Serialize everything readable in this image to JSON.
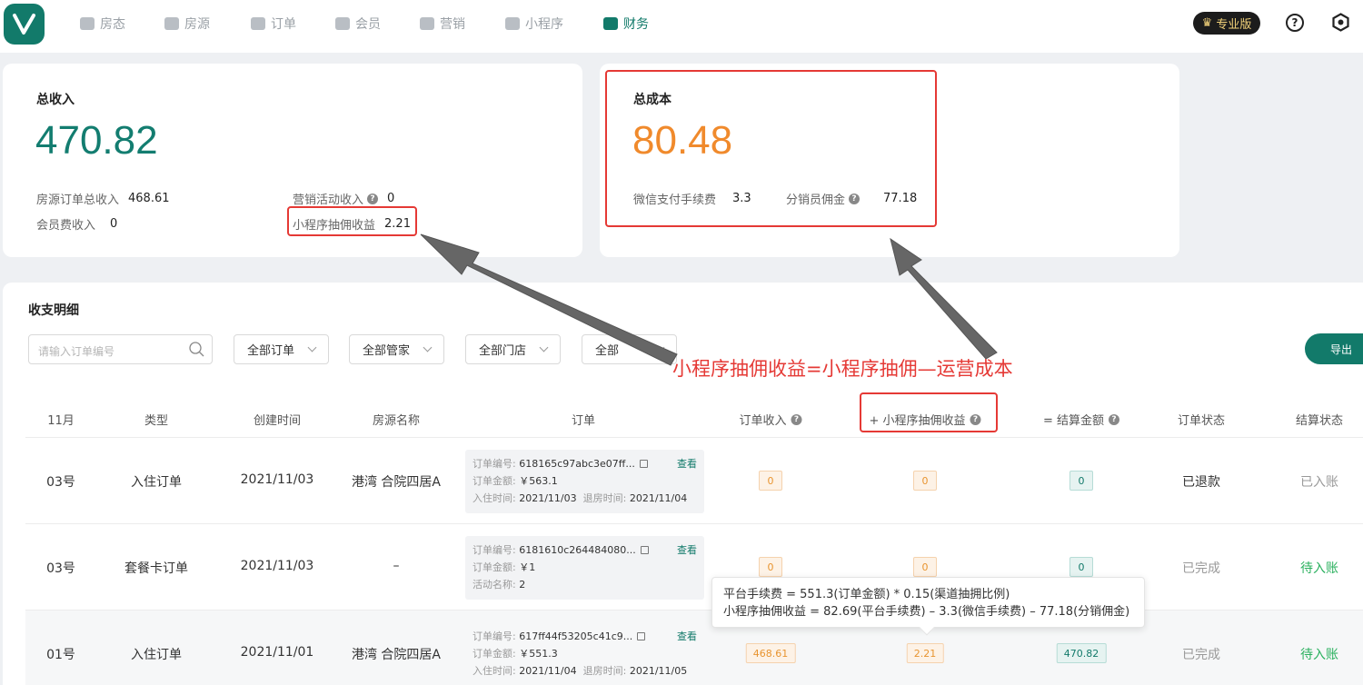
{
  "nav": {
    "items": [
      {
        "label": "房态",
        "icon": "calendar-icon"
      },
      {
        "label": "房源",
        "icon": "building-icon"
      },
      {
        "label": "订单",
        "icon": "clipboard-icon"
      },
      {
        "label": "会员",
        "icon": "diamond-icon"
      },
      {
        "label": "营销",
        "icon": "tag-icon"
      },
      {
        "label": "小程序",
        "icon": "home-icon"
      },
      {
        "label": "财务",
        "icon": "wallet-icon"
      }
    ],
    "active": "财务",
    "pro_label": "专业版"
  },
  "income": {
    "title": "总收入",
    "total": "470.82",
    "room_order_label": "房源订单总收入",
    "room_order_value": "468.61",
    "marketing_label": "营销活动收入",
    "marketing_value": "0",
    "membership_label": "会员费收入",
    "membership_value": "0",
    "miniapp_label": "小程序抽佣收益",
    "miniapp_value": "2.21"
  },
  "cost": {
    "title": "总成本",
    "total": "80.48",
    "wechat_fee_label": "微信支付手续费",
    "wechat_fee_value": "3.3",
    "distributor_label": "分销员佣金",
    "distributor_value": "77.18"
  },
  "detail": {
    "title": "收支明细",
    "search_placeholder": "请输入订单编号",
    "filters": [
      "全部订单",
      "全部管家",
      "全部门店",
      "全部"
    ],
    "export_label": "导出",
    "columns": {
      "month": "11月",
      "type": "类型",
      "created": "创建时间",
      "property": "房源名称",
      "order": "订单",
      "order_income": "订单收入",
      "miniapp_income": "+ 小程序抽佣收益",
      "settle_amount": "= 结算金额",
      "order_status": "订单状态",
      "settle_status": "结算状态"
    },
    "rows": [
      {
        "day": "03号",
        "type": "入住订单",
        "created": "2021/11/03",
        "property": "港湾 合院四居A",
        "l1": "订单编号:",
        "v1": "618165c97abc3e07ff...",
        "l2": "订单金额:",
        "v2": "￥563.1",
        "l3": "入住时间:",
        "v3": "2021/11/03",
        "l4": "退房时间:",
        "v4": "2021/11/04",
        "view": "查看",
        "order_income": "0",
        "miniapp_income": "0",
        "settle_amount": "0",
        "order_status": "已退款",
        "settle_status": "已入账"
      },
      {
        "day": "03号",
        "type": "套餐卡订单",
        "created": "2021/11/03",
        "property": "–",
        "l1": "订单编号:",
        "v1": "6181610c264484080...",
        "l2": "订单金额:",
        "v2": "￥1",
        "l3": "活动名称:",
        "v3": "2",
        "l4": "",
        "v4": "",
        "view": "查看",
        "order_income": "0",
        "miniapp_income": "0",
        "settle_amount": "0",
        "order_status": "已完成",
        "settle_status": "待入账"
      },
      {
        "day": "01号",
        "type": "入住订单",
        "created": "2021/11/01",
        "property": "港湾 合院四居A",
        "l1": "订单编号:",
        "v1": "617ff44f53205c41c9...",
        "l2": "订单金额:",
        "v2": "￥551.3",
        "l3": "入住时间:",
        "v3": "2021/11/04",
        "l4": "退房时间:",
        "v4": "2021/11/05",
        "view": "查看",
        "order_income": "468.61",
        "miniapp_income": "2.21",
        "settle_amount": "470.82",
        "order_status": "已完成",
        "settle_status": "待入账"
      }
    ]
  },
  "tooltip": {
    "line1": "平台手续费 = 551.3(订单金额) * 0.15(渠道抽拥比例)",
    "line2": "小程序抽佣收益 = 82.69(平台手续费) – 3.3(微信手续费) – 77.18(分销佣金)"
  },
  "annotation": {
    "text": "小程序抽佣收益=小程序抽佣—运营成本",
    "color": "#e53935"
  },
  "colors": {
    "brand": "#127a6a",
    "income_total": "#137d70",
    "cost_total": "#f08a2c",
    "pending": "#2ab05e"
  }
}
